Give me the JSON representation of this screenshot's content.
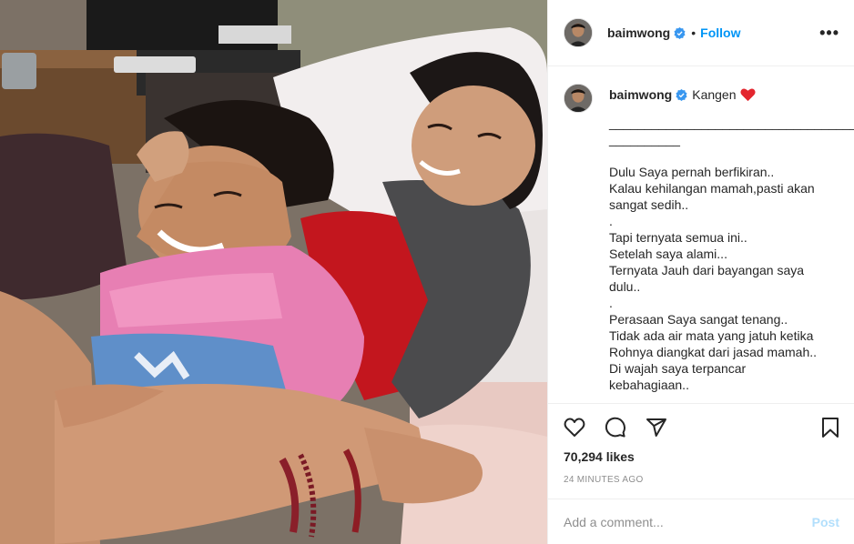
{
  "post": {
    "username": "baimwong",
    "separator": "•",
    "follow_label": "Follow",
    "more_label": "•••",
    "verified_icon": "verified-badge-icon",
    "accent": "#0095f6"
  },
  "caption": {
    "username": "baimwong",
    "first_line": "Kangen",
    "emoji": "red-heart-emoji",
    "lines": [
      "________________________________________",
      "__________",
      "",
      "Dulu Saya pernah berfikiran..",
      "Kalau kehilangan mamah,pasti akan",
      "sangat sedih..",
      ".",
      "Tapi ternyata semua ini..",
      "Setelah saya alami...",
      "Ternyata Jauh dari bayangan saya",
      "dulu..",
      ".",
      "Perasaan Saya sangat tenang..",
      "Tidak ada air mata yang jatuh ketika",
      "Rohnya diangkat dari jasad mamah..",
      "Di wajah saya terpancar",
      "kebahagiaan.."
    ]
  },
  "actions": {
    "like_icon": "heart-icon",
    "comment_icon": "comment-icon",
    "share_icon": "share-icon",
    "save_icon": "bookmark-icon"
  },
  "stats": {
    "likes": "70,294 likes",
    "timestamp": "24 MINUTES AGO"
  },
  "comment": {
    "placeholder": "Add a comment...",
    "post_label": "Post",
    "post_color": "#b2dffc"
  }
}
